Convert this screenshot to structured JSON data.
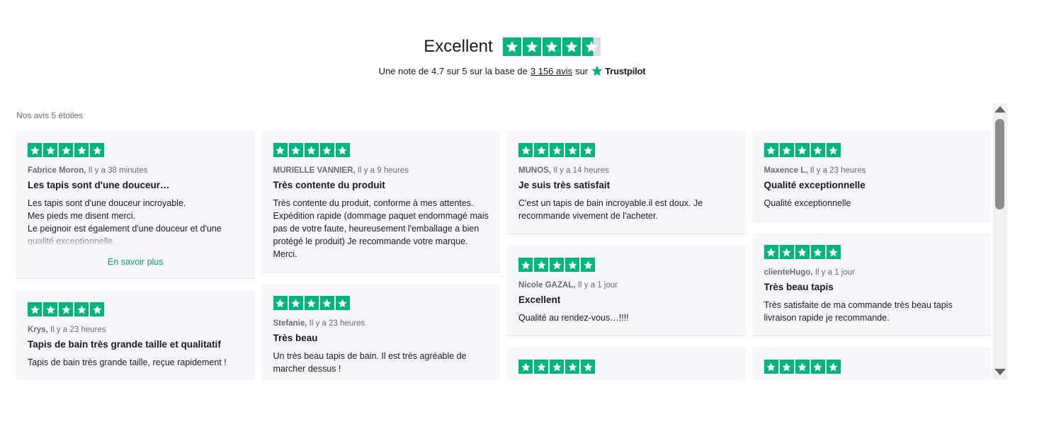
{
  "header": {
    "title": "Excellent",
    "rating_prefix": "Une note de 4.7 sur 5 sur la base de",
    "reviews_link": "3 156 avis",
    "on_text": "sur",
    "brand": "Trustpilot",
    "rating": 4.7
  },
  "section_label": "Nos avis 5 étoiles",
  "colors": {
    "star_green": "#00b67a",
    "empty_star": "#dcdce6",
    "link_green": "#00a56e",
    "card_bg": "#f7f7f9"
  },
  "columns": [
    [
      {
        "author": "Fabrice Moron,",
        "time": "Il y a 38 minutes",
        "title": "Les tapis sont d'une douceur…",
        "body": "Les tapis sont d'une douceur incroyable.\nMes pieds me disent merci.\nLe peignoir est également d'une douceur et d'une qualité exceptionnelle.",
        "more": "En savoir plus",
        "stars": 5
      },
      {
        "author": "Krys,",
        "time": "Il y a 23 heures",
        "title": "Tapis de bain très grande taille et qualitatif",
        "body": "Tapis de bain très grande taille, reçue rapidement !",
        "stars": 5
      }
    ],
    [
      {
        "author": "MURIELLE VANNIER,",
        "time": "Il y a 9 heures",
        "title": "Très contente du produit",
        "body": "Très contente du produit, conforme à mes attentes. Expédition rapide (dommage paquet endommagé mais pas de votre faute, heureusement l'emballage a bien protégé le produit) Je recommande votre marque. Merci.",
        "stars": 5
      },
      {
        "author": "Stefanie,",
        "time": "Il y a 23 heures",
        "title": "Très beau",
        "body": "Un très beau tapis de bain. Il est très agréable de marcher dessus !",
        "stars": 5
      }
    ],
    [
      {
        "author": "MUNOS,",
        "time": "Il y a 14 heures",
        "title": "Je suis très satisfait",
        "body": "C'est un tapis de bain incroyable.il est doux. Je recommande vivement de l'acheter.",
        "stars": 5
      },
      {
        "author": "Nicole GAZAL,",
        "time": "Il y a 1 jour",
        "title": "Excellent",
        "body": "Qualité au rendez-vous…!!!!",
        "stars": 5
      },
      {
        "author": "",
        "time": "",
        "title": "",
        "body": "",
        "stars": 5
      }
    ],
    [
      {
        "author": "Maxence L,",
        "time": "Il y a 23 heures",
        "title": "Qualité exceptionnelle",
        "body": "Qualité exceptionnelle",
        "stars": 5
      },
      {
        "author": "clienteHugo,",
        "time": "Il y a 1 jour",
        "title": "Très beau tapis",
        "body": "Très satisfaite de ma commande très beau tapis livraison rapide je recommande.",
        "stars": 5
      },
      {
        "author": "",
        "time": "",
        "title": "",
        "body": "",
        "stars": 5
      }
    ]
  ]
}
